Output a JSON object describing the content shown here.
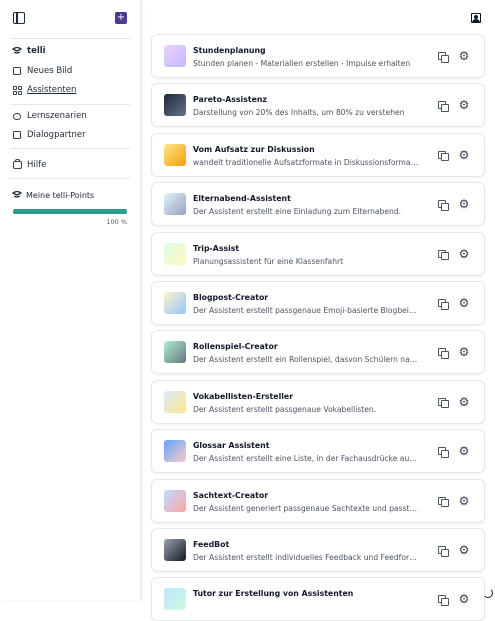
{
  "sidebar": {
    "items": [
      {
        "label": "telli",
        "icon": "telli-logo-icon",
        "active": false,
        "bold": true
      },
      {
        "label": "Neues Bild",
        "icon": "image-icon",
        "active": false
      },
      {
        "label": "Assistenten",
        "icon": "grid-icon",
        "active": true
      },
      {
        "label": "Lernszenarien",
        "icon": "chat-bubble-icon",
        "active": false
      },
      {
        "label": "Dialogpartner",
        "icon": "person-chat-icon",
        "active": false
      },
      {
        "label": "Hilfe",
        "icon": "briefcase-icon",
        "active": false
      }
    ],
    "points": {
      "label": "Meine telli-Points",
      "percent_label": "100 %",
      "value": 1.0
    },
    "accent": "#2f9a8b"
  },
  "assistants": [
    {
      "title": "Stundenplanung",
      "desc": "Stunden planen - Materialien erstellen - Impulse erhalten"
    },
    {
      "title": "Pareto-Assistenz",
      "desc": "Darstellung von 20% des Inhalts, um 80% zu verstehen"
    },
    {
      "title": "Vom Aufsatz zur Diskussion",
      "desc": "wandelt traditionelle Aufsatzformate in Diskussionsformate um. I..."
    },
    {
      "title": "Elternabend-Assistent",
      "desc": "Der Assistent erstellt eine Einladung zum Elternabend."
    },
    {
      "title": "Trip-Assist",
      "desc": "Planungsassistent für eine Klassenfahrt"
    },
    {
      "title": "Blogpost-Creator",
      "desc": "Der Assistent erstellt passgenaue Emoji-basierte Blogbeiträge"
    },
    {
      "title": "Rollenspiel-Creator",
      "desc": "Der Assistent erstellt ein Rollenspiel, dasvon Schülern nachgespie..."
    },
    {
      "title": "Vokabellisten-Ersteller",
      "desc": "Der Assistent erstellt passgenaue Vokabellisten."
    },
    {
      "title": "Glossar Assistent",
      "desc": "Der Assistent erstellt eine Liste, in der Fachausdrücke aus einem ..."
    },
    {
      "title": "Sachtext-Creator",
      "desc": "Der Assistent generiert passgenaue Sachtexte und passt sie unte..."
    },
    {
      "title": "FeedBot",
      "desc": "Der Assistent erstellt individuelles Feedback und Feedforward, au..."
    },
    {
      "title": "Tutor zur Erstellung von Assistenten",
      "desc": ""
    }
  ]
}
